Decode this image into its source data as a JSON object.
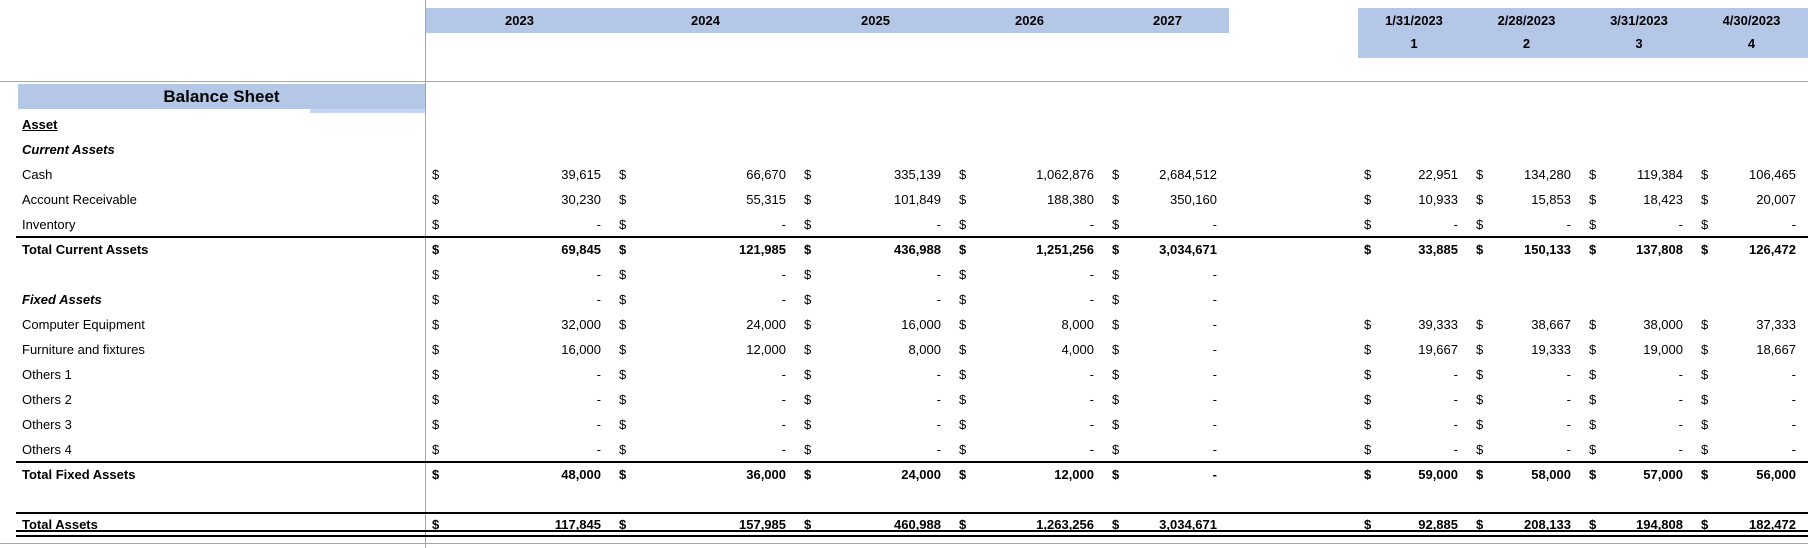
{
  "title": "Balance Sheet",
  "currency_symbol": "$",
  "colors": {
    "background": "#ffffff",
    "text": "#000000",
    "band_fill": "#b4c7e7",
    "band_fill_light": "#c9d6f1",
    "grid_line": "#a6a6a6",
    "border_color": "#000000"
  },
  "header": {
    "year_columns": [
      "2023",
      "2024",
      "2025",
      "2026",
      "2027"
    ],
    "month_columns": [
      {
        "date": "1/31/2023",
        "period": "1"
      },
      {
        "date": "2/28/2023",
        "period": "2"
      },
      {
        "date": "3/31/2023",
        "period": "3"
      },
      {
        "date": "4/30/2023",
        "period": "4"
      }
    ]
  },
  "rows": [
    {
      "key": "asset",
      "label": "Asset",
      "role": "section",
      "years": [
        null,
        null,
        null,
        null,
        null
      ],
      "months": [
        null,
        null,
        null,
        null
      ]
    },
    {
      "key": "current-assets",
      "label": "Current Assets",
      "role": "subsection",
      "years": [
        null,
        null,
        null,
        null,
        null
      ],
      "months": [
        null,
        null,
        null,
        null
      ]
    },
    {
      "key": "cash",
      "label": "Cash",
      "role": "item",
      "years": [
        "39,615",
        "66,670",
        "335,139",
        "1,062,876",
        "2,684,512"
      ],
      "months": [
        "22,951",
        "134,280",
        "119,384",
        "106,465"
      ]
    },
    {
      "key": "account-receivable",
      "label": "Account Receivable",
      "role": "item",
      "years": [
        "30,230",
        "55,315",
        "101,849",
        "188,380",
        "350,160"
      ],
      "months": [
        "10,933",
        "15,853",
        "18,423",
        "20,007"
      ]
    },
    {
      "key": "inventory",
      "label": "Inventory",
      "role": "item",
      "border_bottom": true,
      "years": [
        "-",
        "-",
        "-",
        "-",
        "-"
      ],
      "months": [
        "-",
        "-",
        "-",
        "-"
      ]
    },
    {
      "key": "total-current-assets",
      "label": "Total Current Assets",
      "role": "total",
      "years": [
        "69,845",
        "121,985",
        "436,988",
        "1,251,256",
        "3,034,671"
      ],
      "months": [
        "33,885",
        "150,133",
        "137,808",
        "126,472"
      ]
    },
    {
      "key": "blank-1",
      "label": "",
      "role": "blank",
      "years": [
        "-",
        "-",
        "-",
        "-",
        "-"
      ],
      "months": [
        null,
        null,
        null,
        null
      ]
    },
    {
      "key": "fixed-assets",
      "label": "Fixed Assets",
      "role": "subsection",
      "years": [
        "-",
        "-",
        "-",
        "-",
        "-"
      ],
      "months": [
        null,
        null,
        null,
        null
      ]
    },
    {
      "key": "computer-equipment",
      "label": "Computer Equipment",
      "role": "item",
      "years": [
        "32,000",
        "24,000",
        "16,000",
        "8,000",
        "-"
      ],
      "months": [
        "39,333",
        "38,667",
        "38,000",
        "37,333"
      ]
    },
    {
      "key": "furniture-and-fixtures",
      "label": "Furniture and fixtures",
      "role": "item",
      "years": [
        "16,000",
        "12,000",
        "8,000",
        "4,000",
        "-"
      ],
      "months": [
        "19,667",
        "19,333",
        "19,000",
        "18,667"
      ]
    },
    {
      "key": "others-1",
      "label": "Others 1",
      "role": "item",
      "years": [
        "-",
        "-",
        "-",
        "-",
        "-"
      ],
      "months": [
        "-",
        "-",
        "-",
        "-"
      ]
    },
    {
      "key": "others-2",
      "label": "Others 2",
      "role": "item",
      "years": [
        "-",
        "-",
        "-",
        "-",
        "-"
      ],
      "months": [
        "-",
        "-",
        "-",
        "-"
      ]
    },
    {
      "key": "others-3",
      "label": "Others 3",
      "role": "item",
      "years": [
        "-",
        "-",
        "-",
        "-",
        "-"
      ],
      "months": [
        "-",
        "-",
        "-",
        "-"
      ]
    },
    {
      "key": "others-4",
      "label": "Others 4",
      "role": "item",
      "border_bottom": true,
      "years": [
        "-",
        "-",
        "-",
        "-",
        "-"
      ],
      "months": [
        "-",
        "-",
        "-",
        "-"
      ]
    },
    {
      "key": "total-fixed-assets",
      "label": "Total Fixed Assets",
      "role": "total",
      "years": [
        "48,000",
        "36,000",
        "24,000",
        "12,000",
        "-"
      ],
      "months": [
        "59,000",
        "58,000",
        "57,000",
        "56,000"
      ]
    },
    {
      "key": "blank-2",
      "label": "",
      "role": "blank",
      "years": [
        null,
        null,
        null,
        null,
        null
      ],
      "months": [
        null,
        null,
        null,
        null
      ]
    },
    {
      "key": "total-assets",
      "label": "Total Assets",
      "role": "grand-total",
      "border_top": true,
      "double_bottom": true,
      "years": [
        "117,845",
        "157,985",
        "460,988",
        "1,263,256",
        "3,034,671"
      ],
      "months": [
        "92,885",
        "208,133",
        "194,808",
        "182,472"
      ]
    }
  ]
}
